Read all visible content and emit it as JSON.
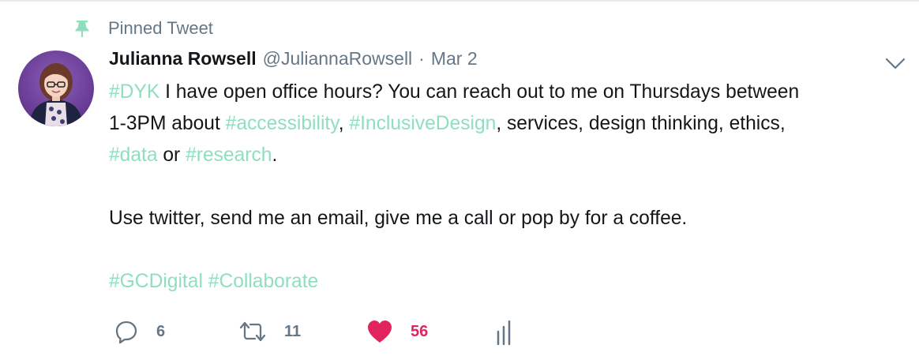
{
  "pinned": {
    "label": "Pinned Tweet",
    "icon": "pin-icon"
  },
  "author": {
    "name": "Julianna Rowsell",
    "handle": "@JuliannaRowsell",
    "separator": "·",
    "date": "Mar 2"
  },
  "tweet": {
    "line1": {
      "tag": "#DYK",
      "text": " I have open office hours? You can reach out to me on Thursdays between"
    },
    "line2": {
      "pre": "1-3PM about ",
      "tag1": "#accessibility",
      "mid1": ", ",
      "tag2": "#InclusiveDesign",
      "post": ", services, design thinking, ethics,"
    },
    "line3": {
      "tag1": "#data",
      "mid": " or ",
      "tag2": "#research",
      "post": "."
    },
    "para2": "Use twitter, send me an email, give me a call or pop by for a coffee.",
    "para3": {
      "tag1": "#GCDigital",
      "space": " ",
      "tag2": "#Collaborate"
    }
  },
  "actions": {
    "reply_count": "6",
    "retweet_count": "11",
    "like_count": "56"
  },
  "colors": {
    "hashtag": "#8fdfbe",
    "like": "#e0245e",
    "muted": "#657786",
    "pin": "#8fdfbe"
  },
  "icons": [
    "pin-icon",
    "caret-down-icon",
    "reply-icon",
    "retweet-icon",
    "heart-icon",
    "analytics-icon"
  ]
}
